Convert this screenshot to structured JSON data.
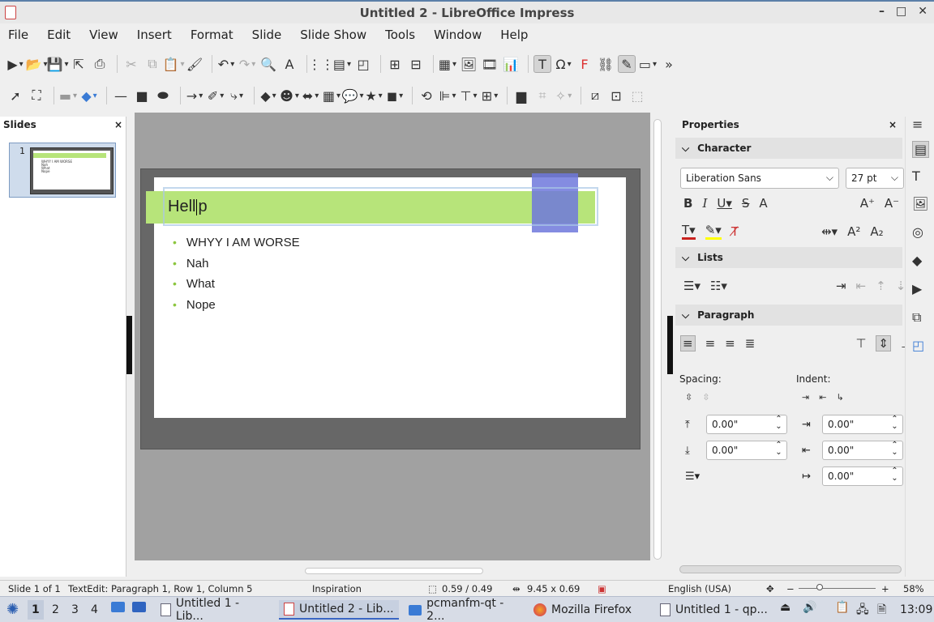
{
  "window": {
    "title": "Untitled 2 - LibreOffice Impress",
    "controls": [
      "–",
      "□",
      "✕"
    ]
  },
  "menu": [
    "File",
    "Edit",
    "View",
    "Insert",
    "Format",
    "Slide",
    "Slide Show",
    "Tools",
    "Window",
    "Help"
  ],
  "slides_panel": {
    "title": "Slides",
    "close": "×",
    "slide_number": "1",
    "thumb_lines": [
      "WHYY I AM WORSE",
      "Nah",
      "What",
      "Nope"
    ]
  },
  "slide": {
    "title_before_caret": "Hell",
    "title_after_caret": "p",
    "bullets": [
      "WHYY I AM WORSE",
      "Nah",
      "What",
      "Nope"
    ],
    "colors": {
      "title_bar": "#b7e47a",
      "bullet": "#8cc63f",
      "rect": "#6e78dc"
    }
  },
  "properties": {
    "title": "Properties",
    "close": "×",
    "menu": "≡",
    "character": {
      "heading": "Character",
      "font_name": "Liberation Sans",
      "font_size": "27 pt"
    },
    "lists": {
      "heading": "Lists"
    },
    "paragraph": {
      "heading": "Paragraph",
      "spacing_label": "Spacing:",
      "indent_label": "Indent:",
      "spacing_above": "0.00\"",
      "spacing_below": "0.00\"",
      "indent_before": "0.00\"",
      "indent_after": "0.00\"",
      "indent_first": "0.00\""
    }
  },
  "statusbar": {
    "slide_info": "Slide 1 of 1",
    "edit_info": "TextEdit: Paragraph 1, Row 1, Column 5",
    "master": "Inspiration",
    "position": "0.59 / 0.49",
    "size": "9.45 x 0.69",
    "language": "English (USA)",
    "zoom_minus": "−",
    "zoom_plus": "+",
    "zoom": "58%"
  },
  "taskbar": {
    "workspaces": [
      "1",
      "2",
      "3",
      "4"
    ],
    "items": [
      "Untitled 1 - Lib...",
      "Untitled 2 - Lib...",
      "pcmanfm-qt - 2...",
      "Mozilla Firefox",
      "Untitled 1 - qp..."
    ],
    "clock": "13:09"
  }
}
